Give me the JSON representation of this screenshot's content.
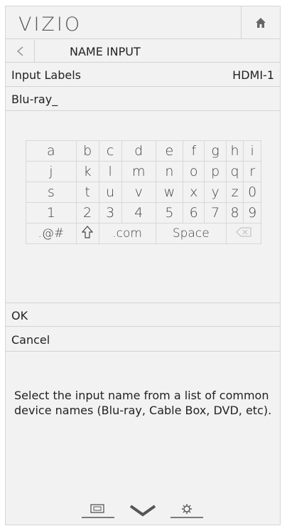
{
  "header": {
    "logo": "VIZIO",
    "home_icon": "home-icon"
  },
  "titlebar": {
    "back_icon": "back-arrow-icon",
    "title": "NAME INPUT"
  },
  "input_labels": {
    "label": "Input Labels",
    "value": "HDMI-1"
  },
  "name_field": {
    "value": "Blu-ray_"
  },
  "keyboard": {
    "rows": [
      [
        "a",
        "b",
        "c",
        "d",
        "e",
        "f",
        "g",
        "h",
        "i"
      ],
      [
        "j",
        "k",
        "l",
        "m",
        "n",
        "o",
        "p",
        "q",
        "r"
      ],
      [
        "s",
        "t",
        "u",
        "v",
        "w",
        "x",
        "y",
        "z",
        "0"
      ],
      [
        "1",
        "2",
        "3",
        "4",
        "5",
        "6",
        "7",
        "8",
        "9"
      ]
    ],
    "special": {
      "symbols": ".@#",
      "shift_icon": "shift-arrow-icon",
      "dotcom": ".com",
      "space": "Space",
      "backspace_icon": "backspace-icon"
    }
  },
  "actions": {
    "ok": "OK",
    "cancel": "Cancel"
  },
  "help_text": "Select the input name from a list of common device names (Blu-ray, Cable Box, DVD, etc).",
  "bottom_nav": {
    "left_icon": "screen-icon",
    "center_icon": "chevron-down-icon",
    "right_icon": "gear-icon"
  }
}
